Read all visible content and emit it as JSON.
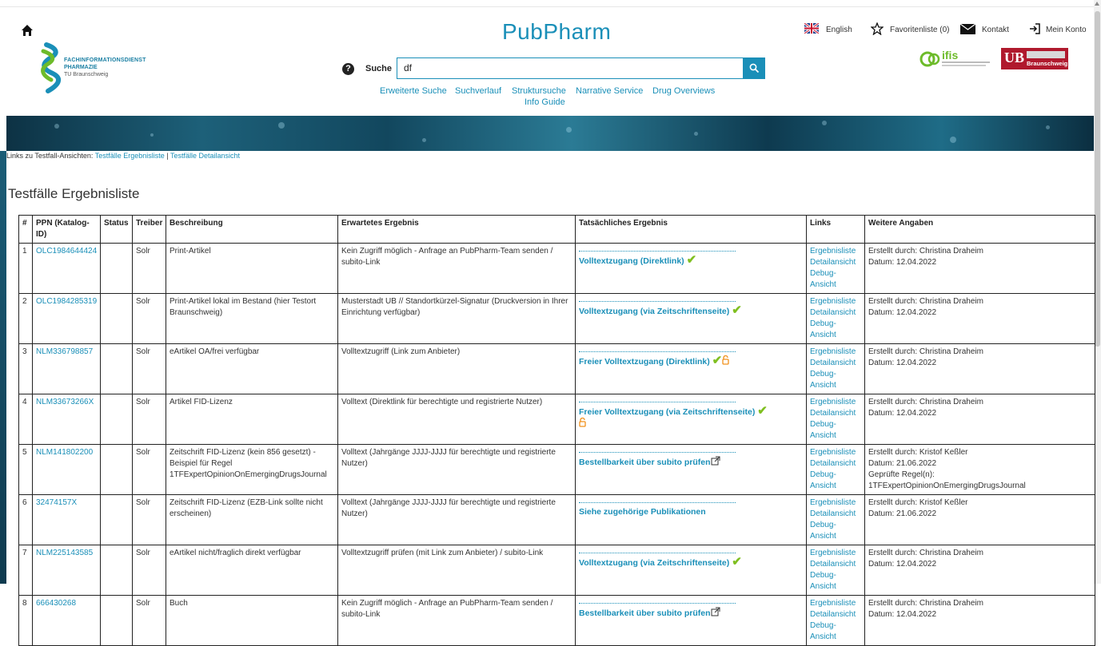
{
  "brand": "PubPharm",
  "logo": {
    "line1": "FACHINFORMATIONSDIENST",
    "line2": "PHARMAZIE",
    "line3": "TU Braunschweig"
  },
  "search": {
    "label": "Suche",
    "value": "df"
  },
  "subnav": [
    "Erweiterte Suche",
    "Suchverlauf",
    "Struktursuche",
    "Info Guide",
    "Narrative Service",
    "Drug Overviews"
  ],
  "topnav": {
    "language": "English",
    "favorites": "Favoritenliste (0)",
    "contact": "Kontakt",
    "account": "Mein Konto"
  },
  "partners": {
    "ifis": "ifis",
    "ub": "UB",
    "ub_sub": "Braunschweig"
  },
  "testlinks": {
    "prefix": "Links zu Testfall-Ansichten:",
    "link1": "Testfälle Ergebnisliste",
    "sep": "|",
    "link2": "Testfälle Detailansicht"
  },
  "page_title": "Testfälle Ergebnisliste",
  "table": {
    "headers": [
      "#",
      "PPN (Katalog-ID)",
      "Status",
      "Treiber",
      "Beschreibung",
      "Erwartetes Ergebnis",
      "Tatsächliches Ergebnis",
      "Links",
      "Weitere Angaben"
    ],
    "link_labels": [
      "Ergebnisliste",
      "Detailansicht",
      "Debug-Ansicht"
    ],
    "rows": [
      {
        "num": "1",
        "ppn": "OLC1984644424",
        "status": "",
        "treiber": "Solr",
        "beschreibung": "Print-Artikel",
        "erwartet": "Kein Zugriff möglich - Anfrage an PubPharm-Team senden / subito-Link",
        "result": "Volltextzugang (Direktlink)",
        "icon": "check",
        "created": "Erstellt durch: Christina Draheim",
        "date": "Datum: 12.04.2022",
        "extra1": "",
        "extra2": ""
      },
      {
        "num": "2",
        "ppn": "OLC1984285319",
        "status": "",
        "treiber": "Solr",
        "beschreibung": "Print-Artikel lokal im Bestand (hier Testort Braunschweig)",
        "erwartet": "Musterstadt UB // Standortkürzel-Signatur (Druckversion in Ihrer Einrichtung verfügbar)",
        "result": "Volltextzugang (via Zeitschriftenseite)",
        "icon": "check",
        "created": "Erstellt durch: Christina Draheim",
        "date": "Datum: 12.04.2022",
        "extra1": "",
        "extra2": ""
      },
      {
        "num": "3",
        "ppn": "NLM336798857",
        "status": "",
        "treiber": "Solr",
        "beschreibung": "eArtikel OA/frei verfügbar",
        "erwartet": "Volltextzugriff (Link zum Anbieter)",
        "result": "Freier Volltextzugang (Direktlink)",
        "icon": "check-lock",
        "created": "Erstellt durch: Christina Draheim",
        "date": "Datum: 12.04.2022",
        "extra1": "",
        "extra2": ""
      },
      {
        "num": "4",
        "ppn": "NLM33673266X",
        "status": "",
        "treiber": "Solr",
        "beschreibung": "Artikel FID-Lizenz",
        "erwartet": "Volltext (Direktlink für berechtigte und registrierte Nutzer)",
        "result": "Freier Volltextzugang (via Zeitschriftenseite)",
        "icon": "check-lock-below",
        "created": "Erstellt durch: Christina Draheim",
        "date": "Datum: 12.04.2022",
        "extra1": "",
        "extra2": ""
      },
      {
        "num": "5",
        "ppn": "NLM141802200",
        "status": "",
        "treiber": "Solr",
        "beschreibung": "Zeitschrift FID-Lizenz (kein 856 gesetzt) - Beispiel für Regel 1TFExpertOpinionOnEmergingDrugsJournal",
        "erwartet": "Volltext (Jahrgänge JJJJ-JJJJ für berechtigte und registrierte Nutzer)",
        "result": "Bestellbarkeit über subito prüfen",
        "icon": "ext",
        "created": "Erstellt durch: Kristof Keßler",
        "date": "Datum: 21.06.2022",
        "extra1": "Geprüfte Regel(n):",
        "extra2": "1TFExpertOpinionOnEmergingDrugsJournal"
      },
      {
        "num": "6",
        "ppn": "32474157X",
        "status": "",
        "treiber": "Solr",
        "beschreibung": "Zeitschrift FID-Lizenz (EZB-Link sollte nicht erscheinen)",
        "erwartet": "Volltext (Jahrgänge JJJJ-JJJJ für berechtigte und registrierte Nutzer)",
        "result": "Siehe zugehörige Publikationen",
        "icon": "none",
        "created": "Erstellt durch: Kristof Keßler",
        "date": "Datum: 21.06.2022",
        "extra1": "",
        "extra2": ""
      },
      {
        "num": "7",
        "ppn": "NLM225143585",
        "status": "",
        "treiber": "Solr",
        "beschreibung": "eArtikel nicht/fraglich direkt verfügbar",
        "erwartet": "Volltextzugriff prüfen (mit Link zum Anbieter) / subito-Link",
        "result": "Volltextzugang (via Zeitschriftenseite)",
        "icon": "check",
        "created": "Erstellt durch: Christina Draheim",
        "date": "Datum: 12.04.2022",
        "extra1": "",
        "extra2": ""
      },
      {
        "num": "8",
        "ppn": "666430268",
        "status": "",
        "treiber": "Solr",
        "beschreibung": "Buch",
        "erwartet": "Kein Zugriff möglich - Anfrage an PubPharm-Team senden / subito-Link",
        "result": "Bestellbarkeit über subito prüfen",
        "icon": "ext",
        "created": "Erstellt durch: Christina Draheim",
        "date": "Datum: 12.04.2022",
        "extra1": "",
        "extra2": ""
      }
    ]
  }
}
